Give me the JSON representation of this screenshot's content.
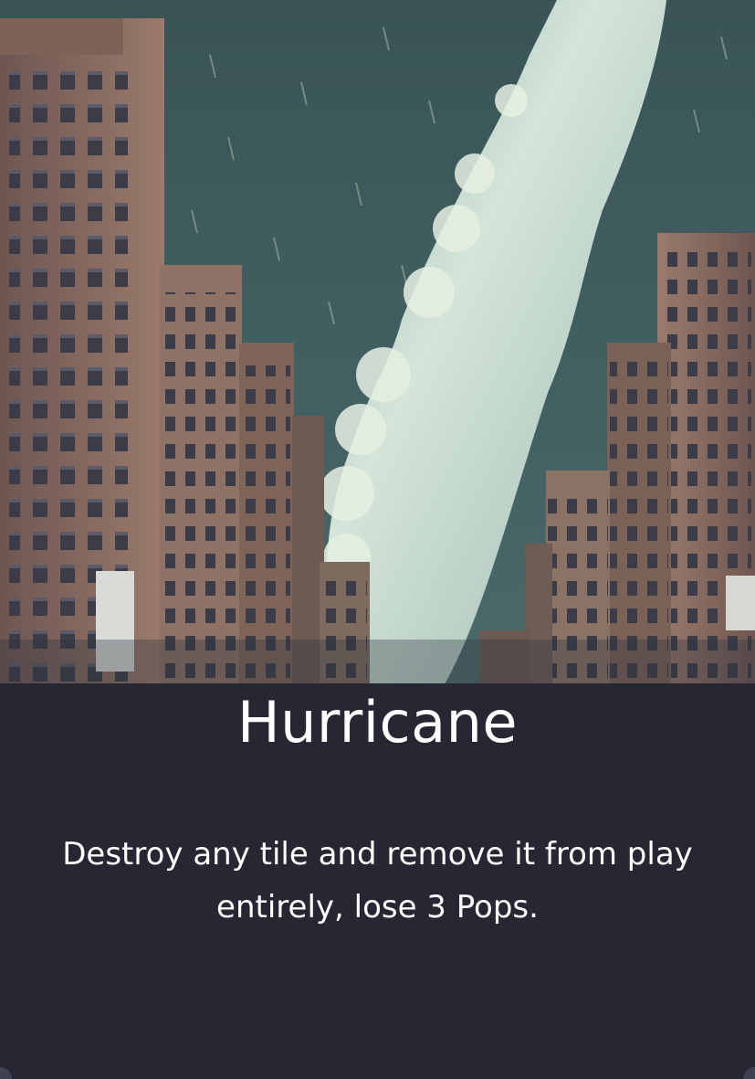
{
  "card": {
    "title": "Hurricane",
    "description": "Destroy any tile and remove it from play entirely, lose 3 Pops.",
    "art_subject": "hurricane-city-illustration"
  },
  "colors": {
    "panel": "#262733",
    "sky": "#3f5b5d",
    "storm": "#c7dad0",
    "building": "#8a6b60",
    "text": "#ffffff"
  }
}
